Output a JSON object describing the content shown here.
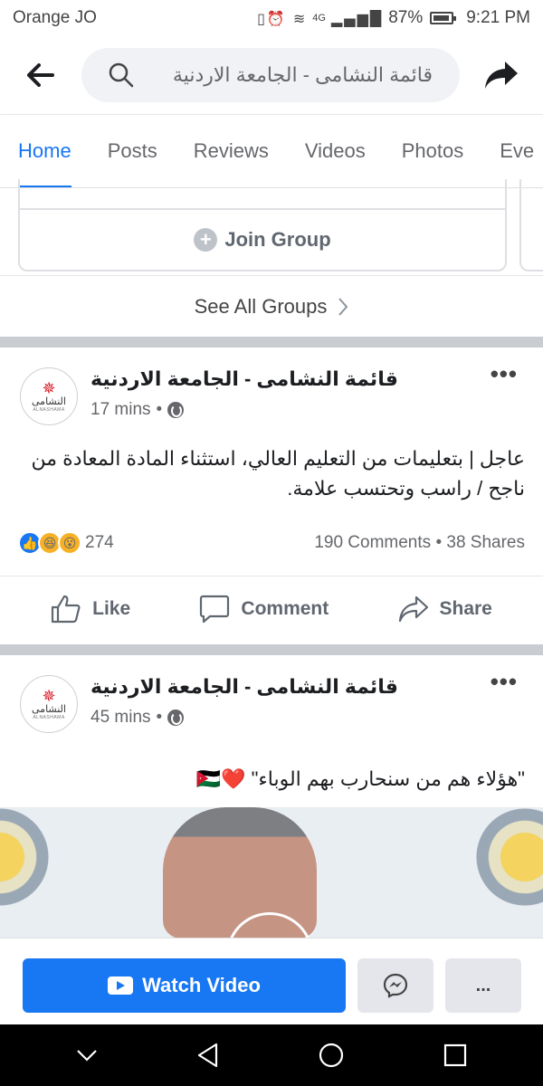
{
  "status_bar": {
    "carrier": "Orange JO",
    "battery_pct": "87%",
    "time": "9:21 PM",
    "network_label": "4G"
  },
  "top_bar": {
    "search_text": "قائمة النشامى - الجامعة الاردنية",
    "back_icon": "arrow-left-icon",
    "share_icon": "share-forward-icon"
  },
  "tabs": [
    {
      "label": "Home",
      "active": true
    },
    {
      "label": "Posts"
    },
    {
      "label": "Reviews"
    },
    {
      "label": "Videos"
    },
    {
      "label": "Photos"
    },
    {
      "label": "Eve"
    }
  ],
  "groups": {
    "join_label": "Join Group",
    "see_all_label": "See All Groups"
  },
  "posts": [
    {
      "author": "قائمة النشامى - الجامعة الاردنية",
      "time": "17 mins",
      "text": "عاجل | بتعليمات من التعليم العالي، استثناء المادة المعادة من ناجح / راسب وتحتسب علامة.",
      "reactions_count": "274",
      "comments": "190 Comments",
      "shares": "38 Shares",
      "actions": {
        "like": "Like",
        "comment": "Comment",
        "share": "Share"
      }
    },
    {
      "author": "قائمة النشامى - الجامعة الاردنية",
      "time": "45 mins",
      "text": "\"هؤلاء هم من سنحارب بهم الوباء\" ❤️🇯🇴"
    }
  ],
  "avatar": {
    "text": "النشامى",
    "sub": "ALNASHAMA"
  },
  "cta": {
    "watch_label": "Watch Video",
    "more_label": "..."
  },
  "colors": {
    "accent": "#1877f2",
    "separator": "#c9ccd1",
    "nav_bar": "#000000"
  }
}
